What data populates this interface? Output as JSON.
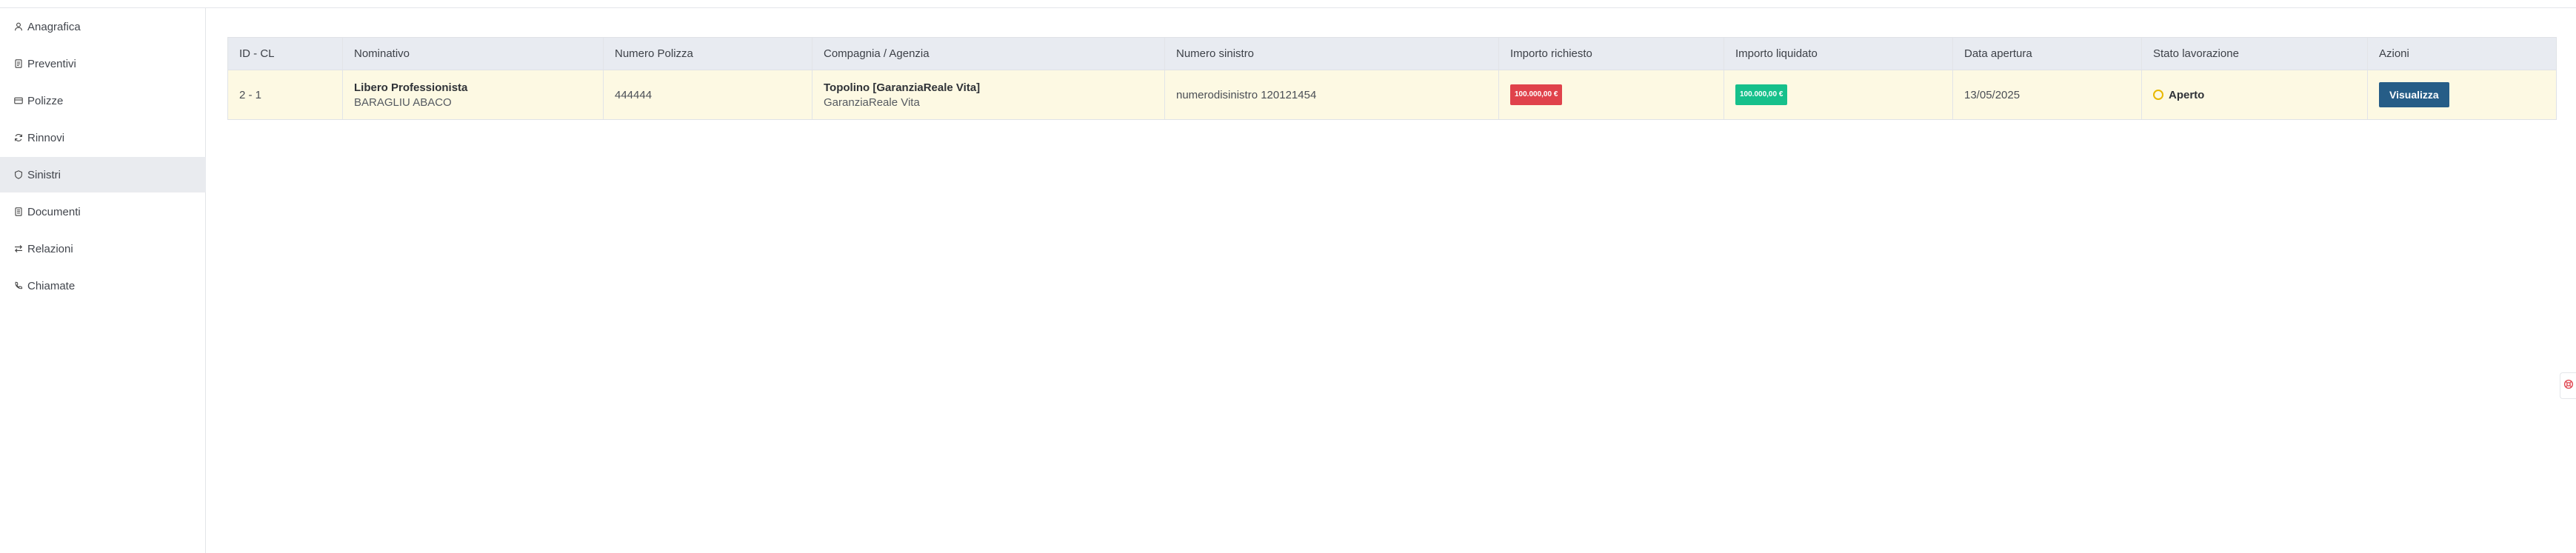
{
  "sidebar": {
    "items": [
      {
        "label": "Anagrafica",
        "icon": "user-icon",
        "active": false
      },
      {
        "label": "Preventivi",
        "icon": "document-icon",
        "active": false
      },
      {
        "label": "Polizze",
        "icon": "policy-icon",
        "active": false
      },
      {
        "label": "Rinnovi",
        "icon": "refresh-icon",
        "active": false
      },
      {
        "label": "Sinistri",
        "icon": "shield-icon",
        "active": true
      },
      {
        "label": "Documenti",
        "icon": "file-icon",
        "active": false
      },
      {
        "label": "Relazioni",
        "icon": "swap-icon",
        "active": false
      },
      {
        "label": "Chiamate",
        "icon": "phone-icon",
        "active": false
      }
    ]
  },
  "table": {
    "headers": {
      "id": "ID - CL",
      "nominativo": "Nominativo",
      "polizza": "Numero Polizza",
      "compagnia": "Compagnia / Agenzia",
      "sinistro": "Numero sinistro",
      "richiesto": "Importo richiesto",
      "liquidato": "Importo liquidato",
      "apertura": "Data apertura",
      "stato": "Stato lavorazione",
      "azioni": "Azioni"
    },
    "rows": [
      {
        "id": "2 - 1",
        "nominativo_title": "Libero Professionista",
        "nominativo_name": "BARAGLIU ABACO",
        "polizza": "444444",
        "compagnia_title": "Topolino [GaranziaReale Vita]",
        "compagnia_sub": "GaranziaReale Vita",
        "sinistro": "numerodisinistro 120121454",
        "richiesto": "100.000,00 €",
        "liquidato": "100.000,00 €",
        "apertura": "13/05/2025",
        "stato": "Aperto",
        "azione": "Visualizza"
      }
    ]
  },
  "colors": {
    "accent": "#265d87",
    "requested_badge": "#e0424b",
    "settled_badge": "#16c08b",
    "row_highlight": "#fdf9e3",
    "status_open": "#e8b800"
  }
}
